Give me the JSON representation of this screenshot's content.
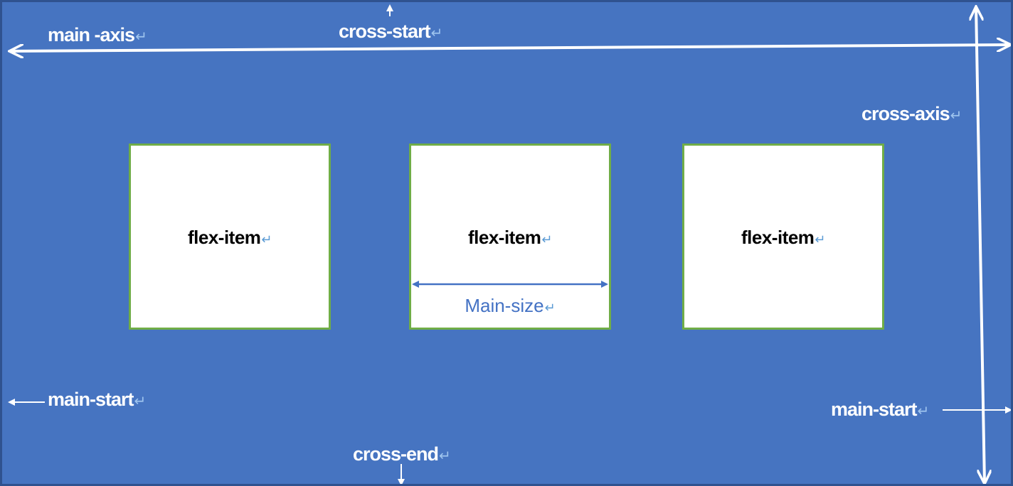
{
  "colors": {
    "background": "#4674c1",
    "item_border": "#70ad47",
    "item_fill": "#ffffff",
    "arrow": "#ffffff",
    "main_size_arrow": "#4472c4"
  },
  "return_glyph": "↵",
  "labels": {
    "main_axis": "main -axis",
    "cross_start": "cross-start",
    "cross_axis": "cross-axis",
    "main_start_left": "main-start",
    "main_start_right": "main-start",
    "cross_end": "cross-end"
  },
  "items": [
    {
      "label": "flex-item"
    },
    {
      "label": "flex-item",
      "size_label": "Main-size"
    },
    {
      "label": "flex-item"
    }
  ]
}
